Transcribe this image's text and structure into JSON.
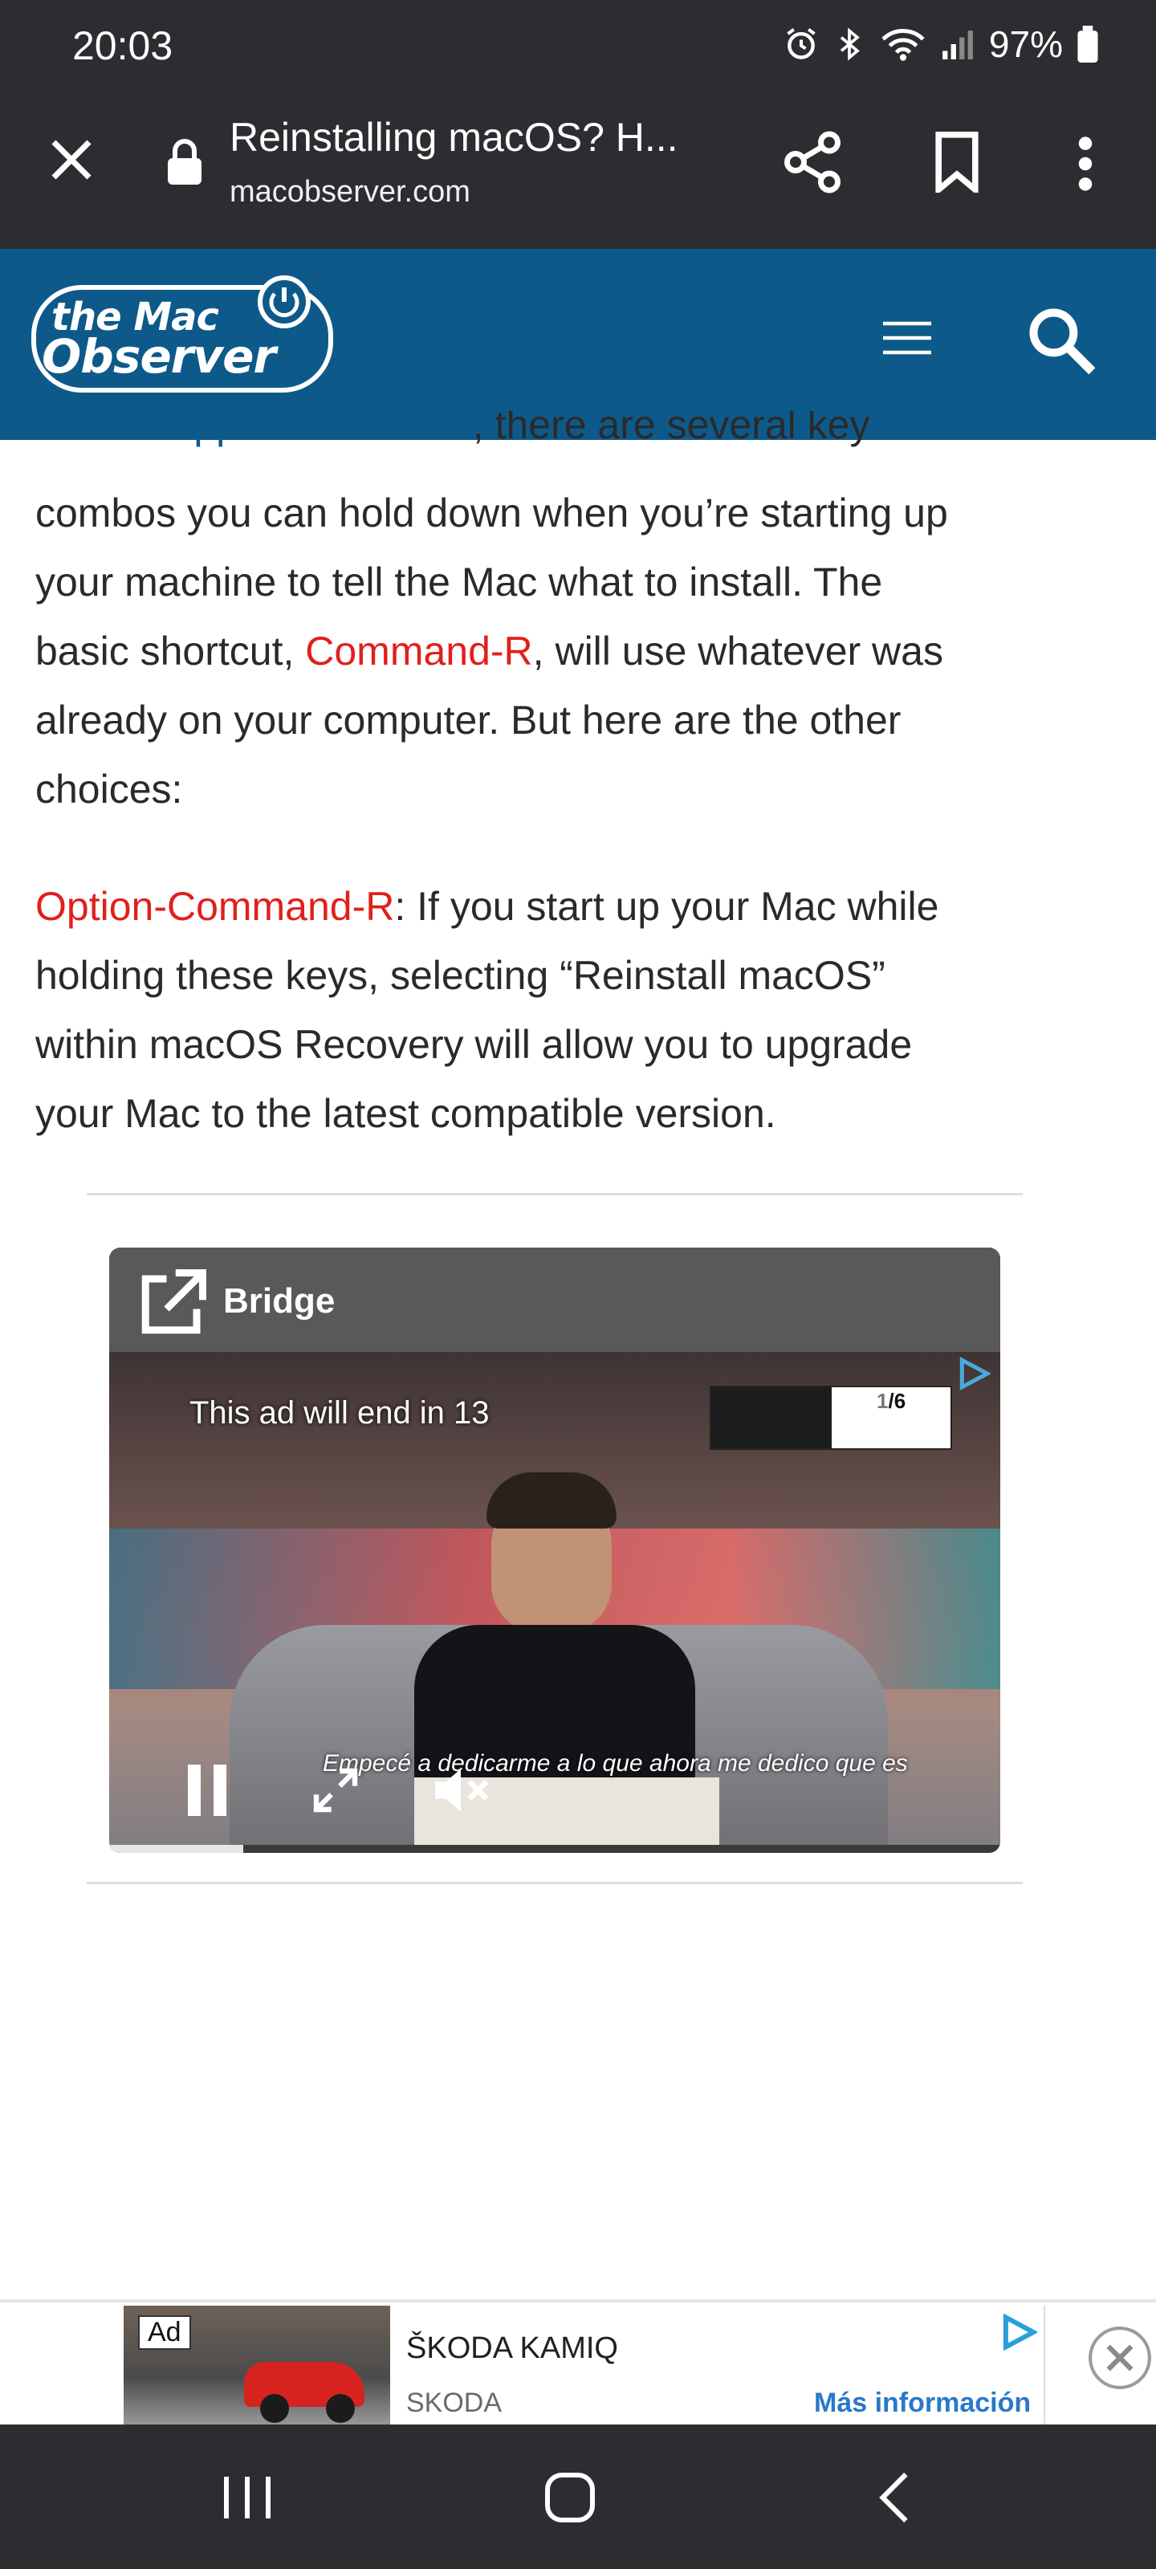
{
  "status_bar": {
    "time": "20:03",
    "battery": "97%"
  },
  "browser": {
    "tab_title": "Reinstalling macOS? H...",
    "url": "macobserver.com"
  },
  "site": {
    "logo_line1": "the Mac",
    "logo_line2": "Observer"
  },
  "article": {
    "p1_link": "in this support document",
    "p1_after_link": ", there are several key",
    "p1_line2": "combos you can hold down when you’re starting up",
    "p1_line3": "your machine to tell the Mac what to install. The",
    "p1_line4_pre": "basic shortcut, ",
    "p1_line4_key": "Command-R",
    "p1_line4_post": ", will use whatever was",
    "p1_line5": "already on your computer. But here are the other",
    "p1_line6": "choices:",
    "p2_key": "Option-Command-R",
    "p2_line1_post": ": If you start up your Mac while",
    "p2_line2": "holding these keys, selecting “Reinstall macOS”",
    "p2_line3": "within macOS Recovery will allow you to upgrade",
    "p2_line4": "your Mac to the latest compatible version."
  },
  "video_ad": {
    "brand": "Bridge",
    "countdown": "This ad will end in 13",
    "counter_current": "1",
    "counter_total": "/6",
    "subtitle": "Empecé a dedicarme a lo que ahora me dedico que es",
    "progress": 0.15
  },
  "banner_ad": {
    "ad_badge": "Ad",
    "title": "ŠKODA KAMIQ",
    "advertiser": "SKODA",
    "cta": "Más información"
  },
  "colors": {
    "chrome": "#2c2d30",
    "site_header": "#0d5a8a",
    "key_highlight": "#e0201b",
    "link": "#0d5a8a",
    "cta": "#2a78c8"
  },
  "icons": [
    "close-icon",
    "lock-icon",
    "share-icon",
    "bookmark-icon",
    "more-icon",
    "menu-icon",
    "search-icon",
    "external-link-icon",
    "pause-icon",
    "fullscreen-icon",
    "mute-icon",
    "adchoices-icon",
    "close-ad-icon",
    "recents-icon",
    "home-icon",
    "back-icon"
  ]
}
